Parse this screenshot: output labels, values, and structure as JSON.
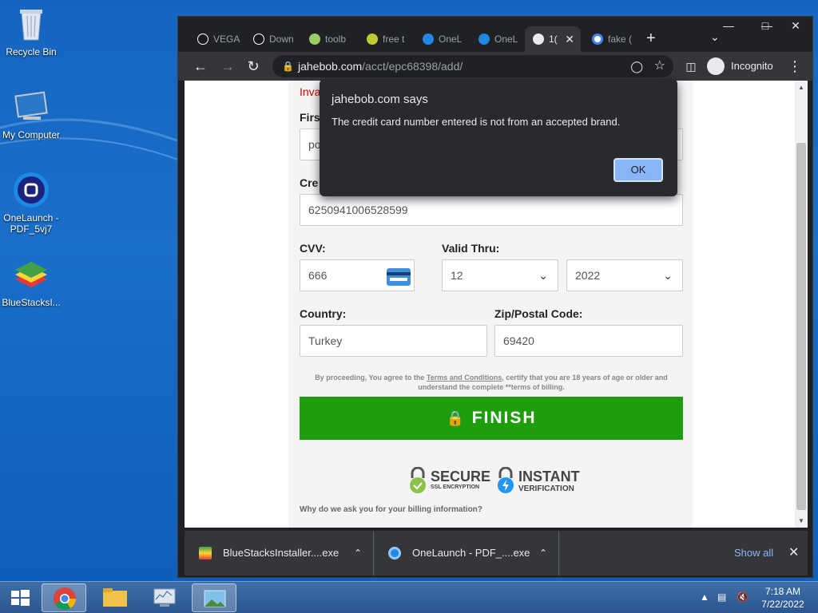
{
  "desktop": {
    "icons": [
      {
        "label": "Recycle Bin"
      },
      {
        "label": "My Computer"
      },
      {
        "label": "OneLaunch - PDF_5vj7"
      },
      {
        "label": "BlueStacksI..."
      }
    ]
  },
  "browser": {
    "tabs": [
      {
        "label": "VEGA"
      },
      {
        "label": "Down"
      },
      {
        "label": "toolb"
      },
      {
        "label": "free t"
      },
      {
        "label": "OneL"
      },
      {
        "label": "OneL"
      },
      {
        "label": "1("
      },
      {
        "label": "fake ("
      }
    ],
    "url_host": "jahebob.com",
    "url_path": "/acct/epc68398/add/",
    "incognito_label": "Incognito"
  },
  "form": {
    "invalid_text": "Inva",
    "first_label": "Firs",
    "first_value": "po",
    "card_label": "Cre",
    "card_value": "6250941006528599",
    "cvv_label": "CVV:",
    "cvv_value": "666",
    "valid_label": "Valid Thru:",
    "month_value": "12",
    "year_value": "2022",
    "country_label": "Country:",
    "country_value": "Turkey",
    "zip_label": "Zip/Postal Code:",
    "zip_value": "69420",
    "terms_pre": "By proceeding, You agree to the ",
    "terms_link": "Terms and Conditions",
    "terms_post": ", certify that you are 18 years of age or older and understand the complete **terms of billing.",
    "finish_label": "FINISH",
    "secure_title": "SECURE",
    "secure_sub": "SSL ENCRYPTION",
    "instant_title": "INSTANT",
    "instant_sub": "VERIFICATION",
    "why_text": "Why do we ask you for your billing information?"
  },
  "dialog": {
    "title": "jahebob.com says",
    "message": "The credit card number entered is not from an accepted brand.",
    "ok_label": "OK"
  },
  "downloads": {
    "items": [
      {
        "label": "BlueStacksInstaller....exe"
      },
      {
        "label": "OnеLaunch - PDF_....exe"
      }
    ],
    "show_all": "Show all"
  },
  "taskbar": {
    "time": "7:18 AM",
    "date": "7/22/2022"
  },
  "colors": {
    "finish_green": "#1e9e0d",
    "dialog_bg": "#292a2d",
    "ok_blue": "#8ab4f8",
    "desktop_blue": "#1565c0"
  }
}
